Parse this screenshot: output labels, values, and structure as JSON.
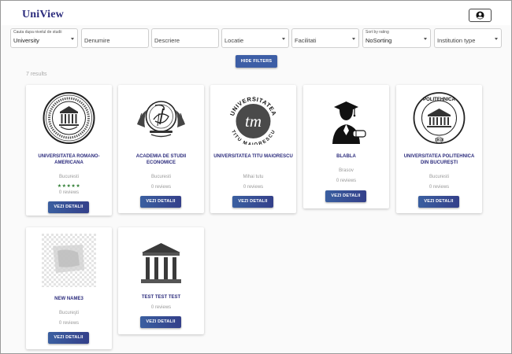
{
  "app": {
    "title": "UniView"
  },
  "header": {
    "account_icon": "account-circle-icon"
  },
  "filters": {
    "level": {
      "label": "Cauta dupa nivelul de studii",
      "value": "University"
    },
    "denumire": {
      "placeholder": "Denumire"
    },
    "descriere": {
      "placeholder": "Descriere"
    },
    "locatie": {
      "placeholder": "Locatie"
    },
    "facilitati": {
      "placeholder": "Facilitati"
    },
    "sort": {
      "label": "Sort by rating",
      "value": "NoSorting"
    },
    "institution_type": {
      "placeholder": "Institution type"
    }
  },
  "hide_filters_label": "HIDE FILTERS",
  "results_count": "7 results",
  "button_label": "VEZI DETALII",
  "colors": {
    "accent": "#3d5ea6",
    "title": "#2c2c7d",
    "stars": "#2e7d32"
  },
  "cards": [
    {
      "name": "UNIVERSITATEA ROMANO-AMERICANA",
      "city": "Bucuresti",
      "stars": "★★★★★",
      "rating_value": 5,
      "reviews": "0 reviews",
      "logo": "seal-logo"
    },
    {
      "name": "ACADEMIA DE STUDII ECONOMICE",
      "city": "Bucuresti",
      "reviews": "0 reviews",
      "logo": "ase-logo"
    },
    {
      "name": "UNIVERSITATEA TITU MAIORESCU",
      "city": "Mihai tutu",
      "reviews": "0 reviews",
      "logo": "tm-logo",
      "logo_text": {
        "arc_top": "UNIVERSITATEA",
        "arc_bottom": "TITU MAIORESCU",
        "mark": "tm"
      }
    },
    {
      "name": "BLABLA",
      "city": "Brasov",
      "reviews": "0 reviews",
      "logo": "graduate-icon"
    },
    {
      "name": "UNIVERSITATEA POLITEHNICA DIN BUCUREȘTI",
      "city": "Bucuresti",
      "reviews": "0 reviews",
      "logo": "politehnica-logo",
      "logo_text": {
        "top": "POLITEHNICA",
        "year": "1818"
      }
    },
    {
      "name": "NEW NAME3",
      "city": "Bucureşti",
      "reviews": "0 reviews",
      "logo": "placeholder-image"
    },
    {
      "name": "TEST TEST TEST",
      "city": "",
      "reviews": "0 reviews",
      "logo": "building-icon"
    }
  ]
}
